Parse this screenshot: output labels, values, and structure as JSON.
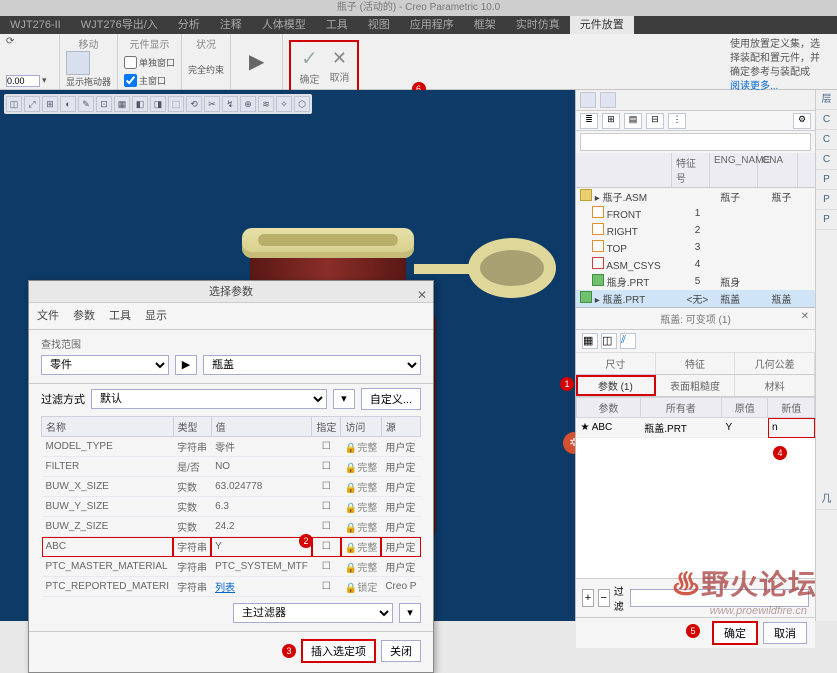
{
  "title": "瓶子 (活动的) - Creo Parametric 10.0",
  "menu": {
    "tabs": [
      "WJT276-II",
      "WJT276导出/入",
      "分析",
      "注释",
      "人体模型",
      "工具",
      "视图",
      "应用程序",
      "框架",
      "实时仿真",
      "元件放置"
    ],
    "active": 10
  },
  "ribbon": {
    "groups": {
      "move": "移动",
      "compDisplay": "元件显示",
      "status": "状况",
      "showDrag": "显示拖动器",
      "separateWin": "单独窗口",
      "mainWin": "主窗口",
      "completeConstraint": "完全约束",
      "confirm": "确定",
      "cancel": "取消"
    },
    "right": {
      "tip": "使用放置定义集，选择装配和置元件，并确定参考与装配成",
      "more": "阅读更多..."
    },
    "badge6": "6"
  },
  "dialog": {
    "title": "选择参数",
    "menu": [
      "文件",
      "参数",
      "工具",
      "显示"
    ],
    "scopeLabel": "查找范围",
    "scopeSelect": "零件",
    "scopePart": "瓶盖",
    "filterLabel": "过滤方式",
    "filterVal": "默认",
    "customize": "自定义...",
    "cols": [
      "名称",
      "类型",
      "值",
      "指定",
      "访问",
      "源"
    ],
    "rows": [
      {
        "name": "MODEL_TYPE",
        "type": "字符串",
        "value": "零件",
        "lock": true,
        "acc": "完整",
        "src": "用户定"
      },
      {
        "name": "FILTER",
        "type": "是/否",
        "value": "NO",
        "lock": true,
        "acc": "完整",
        "src": "用户定"
      },
      {
        "name": "BUW_X_SIZE",
        "type": "实数",
        "value": "63.024778",
        "lock": true,
        "acc": "完整",
        "src": "用户定"
      },
      {
        "name": "BUW_Y_SIZE",
        "type": "实数",
        "value": "6.3",
        "lock": true,
        "acc": "完整",
        "src": "用户定"
      },
      {
        "name": "BUW_Z_SIZE",
        "type": "实数",
        "value": "24.2",
        "lock": true,
        "acc": "完整",
        "src": "用户定"
      },
      {
        "name": "ABC",
        "type": "字符串",
        "value": "Y",
        "lock": true,
        "acc": "完整",
        "src": "用户定",
        "hl": true
      },
      {
        "name": "PTC_MASTER_MATERIAL",
        "type": "字符串",
        "value": "PTC_SYSTEM_MTF",
        "lock": true,
        "acc": "完整",
        "src": "用户定"
      },
      {
        "name": "PTC_REPORTED_MATERI",
        "type": "字符串",
        "value": "列表",
        "link": true,
        "lock": true,
        "acc": "锁定",
        "src": "Creo P"
      }
    ],
    "mainFilter": "主过滤器",
    "insert": "插入选定项",
    "close": "关闭",
    "badge2": "2",
    "badge3": "3"
  },
  "tree": {
    "cols": [
      "",
      "特征号",
      "ENG_NAME",
      "CNA"
    ],
    "nodes": [
      {
        "label": "瓶子.ASM",
        "feat": "",
        "eng": "瓶子",
        "cn": "瓶子",
        "icon": "asm"
      },
      {
        "label": "FRONT",
        "feat": "1",
        "eng": "",
        "cn": "",
        "icon": "datum",
        "indent": 1
      },
      {
        "label": "RIGHT",
        "feat": "2",
        "eng": "",
        "cn": "",
        "icon": "datum",
        "indent": 1
      },
      {
        "label": "TOP",
        "feat": "3",
        "eng": "",
        "cn": "",
        "icon": "datum",
        "indent": 1
      },
      {
        "label": "ASM_CSYS",
        "feat": "4",
        "eng": "",
        "cn": "",
        "icon": "csys",
        "indent": 1
      },
      {
        "label": "瓶身.PRT",
        "feat": "5",
        "eng": "瓶身",
        "cn": "",
        "icon": "part",
        "indent": 1
      },
      {
        "label": "瓶盖.PRT",
        "feat": "<无>",
        "eng": "瓶盖",
        "cn": "瓶盖",
        "icon": "part",
        "indent": 0,
        "selected": true
      }
    ]
  },
  "varopt": {
    "title": "瓶盖: 可变项 (1)",
    "levelTabs": [
      "尺寸",
      "特征",
      "几何公差"
    ],
    "levelTabs2": [
      "参数 (1)",
      "表面粗糙度",
      "材料"
    ],
    "activeL2": 0,
    "badge1": "1",
    "cols": [
      "参数",
      "所有者",
      "原值",
      "新值"
    ],
    "row": {
      "param": "★ ABC",
      "owner": "瓶盖.PRT",
      "orig": "Y",
      "newv": "n"
    },
    "badge4": "4",
    "filter": "过滤",
    "ok": "确定",
    "cancel": "取消",
    "badge5": "5"
  },
  "side": {
    "labels": [
      "层",
      "C",
      "C",
      "C",
      "P",
      "P",
      "P"
    ],
    "low": "几"
  },
  "watermark": {
    "text": "野火论坛",
    "url": "www.proewildfire.cn"
  }
}
